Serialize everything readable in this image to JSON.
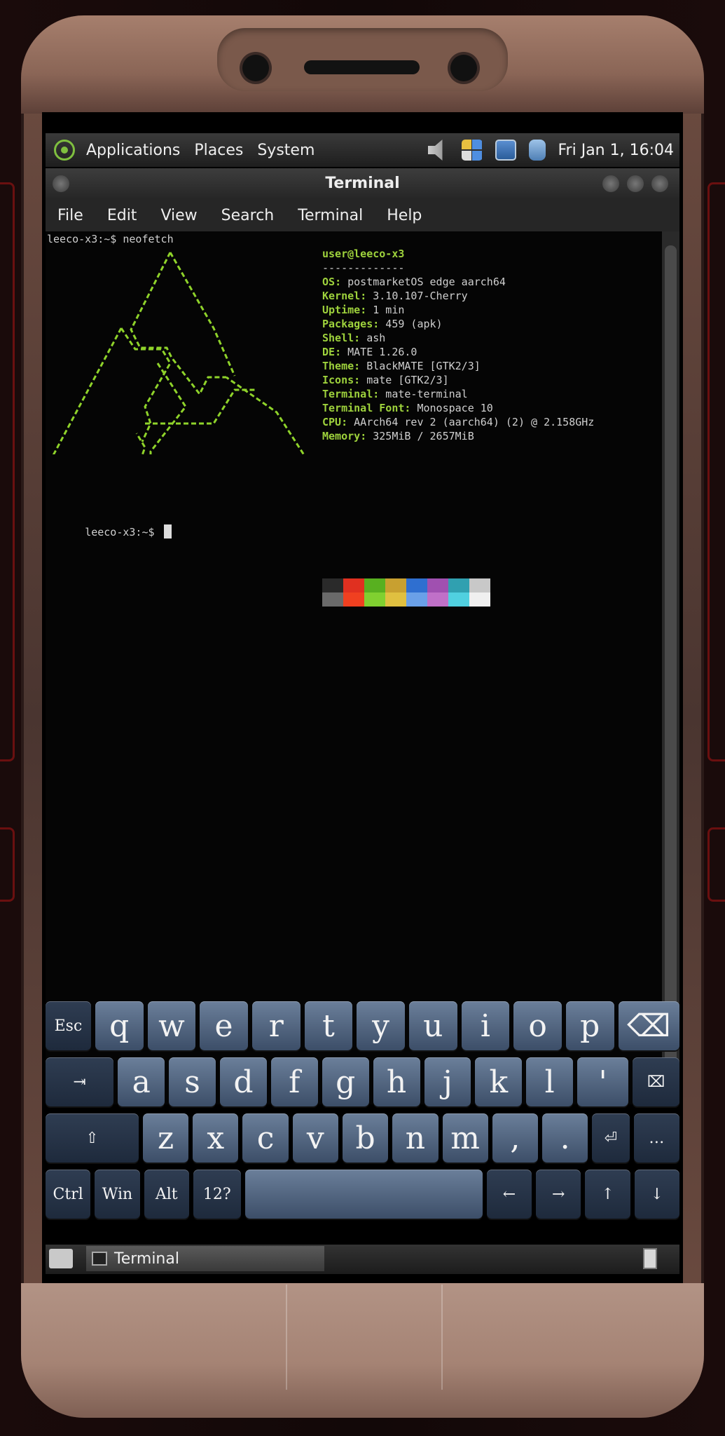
{
  "panel": {
    "menus": [
      "Applications",
      "Places",
      "System"
    ],
    "clock": "Fri Jan  1, 16:04"
  },
  "window": {
    "title": "Terminal",
    "menubar": [
      "File",
      "Edit",
      "View",
      "Search",
      "Terminal",
      "Help"
    ]
  },
  "terminal": {
    "prompt1": "leeco-x3:~$ neofetch",
    "user_host": "user@leeco-x3",
    "separator": "-------------",
    "info": [
      {
        "key": "OS",
        "value": " postmarketOS edge aarch64"
      },
      {
        "key": "Kernel",
        "value": " 3.10.107-Cherry"
      },
      {
        "key": "Uptime",
        "value": " 1 min"
      },
      {
        "key": "Packages",
        "value": " 459 (apk)"
      },
      {
        "key": "Shell",
        "value": " ash"
      },
      {
        "key": "DE",
        "value": " MATE 1.26.0"
      },
      {
        "key": "Theme",
        "value": " BlackMATE [GTK2/3]"
      },
      {
        "key": "Icons",
        "value": " mate [GTK2/3]"
      },
      {
        "key": "Terminal",
        "value": " mate-terminal"
      },
      {
        "key": "Terminal Font",
        "value": " Monospace 10"
      },
      {
        "key": "CPU",
        "value": " AArch64 rev 2 (aarch64) (2) @ 2.158GHz"
      },
      {
        "key": "Memory",
        "value": " 325MiB / 2657MiB"
      }
    ],
    "prompt2": "leeco-x3:~$ ",
    "palette_top": [
      "#2a2a2a",
      "#e03020",
      "#58b020",
      "#c8a030",
      "#2f6fd0",
      "#a050b0",
      "#30a0b0",
      "#c8c8c8"
    ],
    "palette_bottom": [
      "#6a6a6a",
      "#f04020",
      "#80d030",
      "#e0c040",
      "#6aa0e8",
      "#c070c8",
      "#50d0e0",
      "#f0f0f0"
    ]
  },
  "keyboard": {
    "row1": [
      "Esc",
      "q",
      "w",
      "e",
      "r",
      "t",
      "y",
      "u",
      "i",
      "o",
      "p",
      "⌫"
    ],
    "row2": [
      "⇥",
      "a",
      "s",
      "d",
      "f",
      "g",
      "h",
      "j",
      "k",
      "l",
      "'",
      "⌧"
    ],
    "row3": [
      "⇧",
      "z",
      "x",
      "c",
      "v",
      "b",
      "n",
      "m",
      ",",
      ".",
      "⏎",
      "…"
    ],
    "row4": [
      "Ctrl",
      "Win",
      "Alt",
      "12?",
      "",
      "←",
      "→",
      "↑",
      "↓"
    ]
  },
  "taskbar": {
    "task_label": "Terminal"
  }
}
